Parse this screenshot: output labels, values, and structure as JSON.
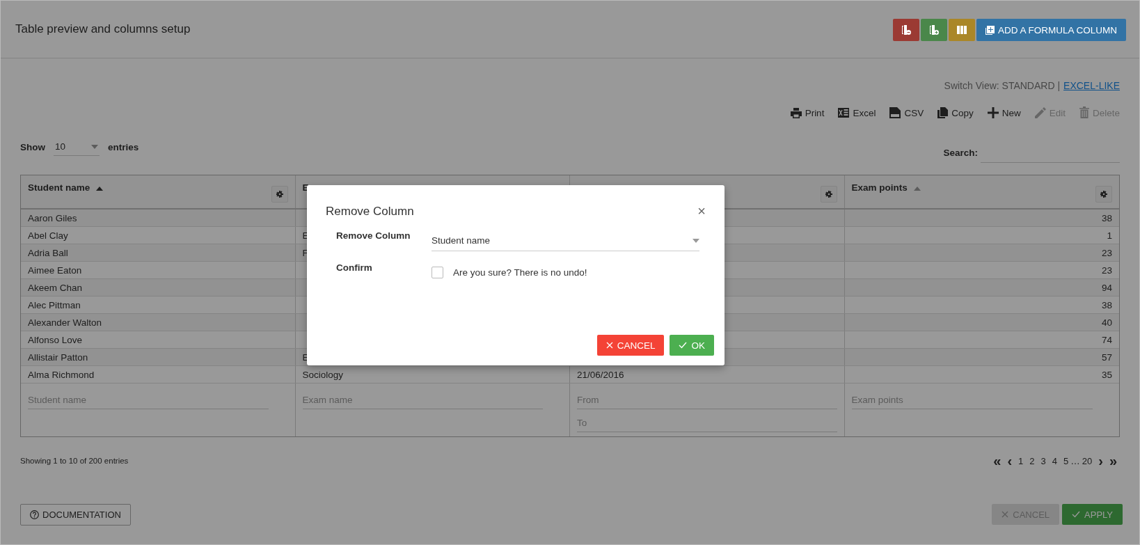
{
  "header": {
    "title": "Table preview and columns setup",
    "actions": [
      {
        "kind": "remove-column",
        "color": "#9b3a33"
      },
      {
        "kind": "add-column",
        "color": "#4a874a"
      },
      {
        "kind": "columns",
        "color": "#aa8728"
      },
      {
        "kind": "formula",
        "color": "#3273a5",
        "label": "ADD A FORMULA COLUMN"
      }
    ]
  },
  "switch_view": {
    "label": "Switch View:",
    "current": "STANDARD",
    "separator": "|",
    "link": "EXCEL-LIKE"
  },
  "toolbar": [
    {
      "kind": "print",
      "label": "Print",
      "disabled": false
    },
    {
      "kind": "excel",
      "label": "Excel",
      "disabled": false
    },
    {
      "kind": "csv",
      "label": "CSV",
      "disabled": false
    },
    {
      "kind": "copy",
      "label": "Copy",
      "disabled": false
    },
    {
      "kind": "new",
      "label": "New",
      "disabled": false
    },
    {
      "kind": "edit",
      "label": "Edit",
      "disabled": true
    },
    {
      "kind": "delete",
      "label": "Delete",
      "disabled": true
    }
  ],
  "length": {
    "label": "Show",
    "value": "10",
    "suffix": "entries"
  },
  "search": {
    "label": "Search:"
  },
  "table": {
    "columns": [
      {
        "label": "Student name",
        "sorted": true,
        "settings": true
      },
      {
        "label": "E"
      },
      {
        "settings": true
      },
      {
        "label": "Exam points",
        "sorted": false,
        "settings": true
      }
    ],
    "rows": [
      {
        "cells": [
          "Aaron Giles",
          null,
          null,
          "38"
        ]
      },
      {
        "cells": [
          "Abel Clay",
          "E",
          null,
          "1"
        ]
      },
      {
        "cells": [
          "Adria Ball",
          "F",
          null,
          "23"
        ]
      },
      {
        "cells": [
          "Aimee Eaton",
          null,
          null,
          "23"
        ]
      },
      {
        "cells": [
          "Akeem Chan",
          null,
          null,
          "94"
        ]
      },
      {
        "cells": [
          "Alec Pittman",
          null,
          null,
          "38"
        ]
      },
      {
        "cells": [
          "Alexander Walton",
          null,
          null,
          "40"
        ]
      },
      {
        "cells": [
          "Alfonso Love",
          null,
          null,
          "74"
        ]
      },
      {
        "cells": [
          "Allistair Patton",
          "E",
          null,
          "57"
        ]
      },
      {
        "cells": [
          "Alma Richmond",
          "Sociology",
          "21/06/2016",
          "35"
        ]
      }
    ],
    "filters": [
      [
        {
          "placeholder": "Student name"
        }
      ],
      [
        {
          "placeholder": "Exam name"
        }
      ],
      [
        {
          "placeholder": "From"
        },
        {
          "placeholder": "To"
        }
      ],
      [
        {
          "placeholder": "Exam points"
        }
      ]
    ]
  },
  "info": "Showing 1 to 10 of 200 entries",
  "pagination": {
    "first": "«",
    "prev": "‹",
    "pages": [
      "1",
      "2",
      "3",
      "4",
      "5"
    ],
    "ellipsis": "…",
    "last_page": "20",
    "next": "›",
    "last": "»"
  },
  "footer": {
    "documentation": "DOCUMENTATION",
    "cancel": {
      "label": "CANCEL",
      "disabled": true
    },
    "apply": {
      "label": "APPLY",
      "disabled": false
    }
  },
  "modal": {
    "title": "Remove Column",
    "close": "×",
    "fields": [
      {
        "kind": "select",
        "label": "Remove Column",
        "value": "Student name"
      },
      {
        "kind": "checkbox",
        "label": "Confirm",
        "text": "Are you sure? There is no undo!",
        "checked": false
      }
    ],
    "cancel": "CANCEL",
    "ok": "OK"
  }
}
